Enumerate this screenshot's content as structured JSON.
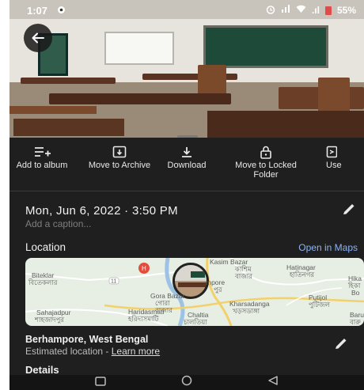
{
  "status_bar": {
    "time": "1:07",
    "signal_text": ".ıl",
    "battery": "55%"
  },
  "actions": [
    {
      "label": "Add to album",
      "icon": "playlist-add-icon"
    },
    {
      "label": "Move to Archive",
      "icon": "archive-icon"
    },
    {
      "label": "Download",
      "icon": "download-icon"
    },
    {
      "label": "Move to Locked Folder",
      "icon": "lock-icon"
    },
    {
      "label": "Use",
      "icon": "use-as-icon"
    }
  ],
  "photo_info": {
    "date": "Mon, Jun 6, 2022 · 3:50 PM",
    "caption_placeholder": "Add a caption..."
  },
  "location": {
    "title": "Location",
    "open_maps": "Open in Maps",
    "place": "Berhampore, West Bengal",
    "estimated": "Estimated location - ",
    "learn_more": "Learn more"
  },
  "map_labels": [
    "Kasim Bazar",
    "কাশিম",
    "বাজার",
    "Hatinagar",
    "হাতিনগর",
    "Hika",
    "হিকা",
    "Bo",
    "Biteklar",
    "বিতেকলার",
    "11",
    "mpore",
    "পুর",
    "Gora Bazar",
    "গোরা",
    "বাজার",
    "Kharsadanga",
    "খড়সডাঙ্গা",
    "Putijol",
    "পুটিজল",
    "Sahajadpur",
    "শাহজাদপুর",
    "Haridasmati",
    "হরিদাসমাটি",
    "Chaltia",
    "চালতিয়া",
    "Baru",
    "বারু"
  ],
  "details_label": "Details",
  "colors": {
    "background": "#1f1f1f",
    "link_blue": "#8ab4f8",
    "battery_red": "#e14b4b",
    "map_bg": "#e7efe4",
    "road_yellow": "#f2d06b",
    "river_blue": "#9cc3e6",
    "marker_red": "#e44c3c"
  }
}
